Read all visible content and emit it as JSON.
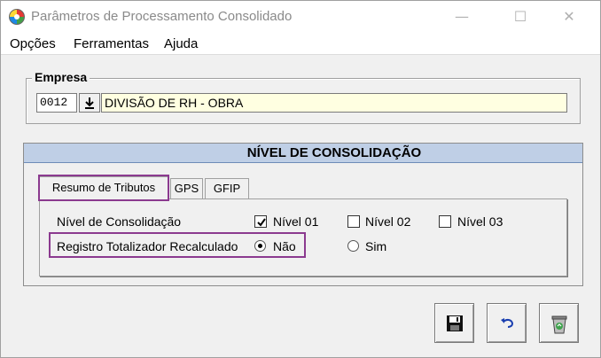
{
  "window": {
    "title": "Parâmetros de Processamento Consolidado",
    "min_symbol": "—",
    "max_symbol": "☐",
    "close_symbol": "✕"
  },
  "menu": {
    "items": [
      "Opções",
      "Ferramentas",
      "Ajuda"
    ]
  },
  "empresa": {
    "legend": "Empresa",
    "code": "0012",
    "name": "DIVISÃO DE RH - OBRA",
    "lookup_icon": "download-arrow-icon",
    "name_field_color": "#ffffe1"
  },
  "consolidacao": {
    "header": "NÍVEL DE CONSOLIDAÇÃO",
    "header_color": "#bfcfe6",
    "tabs": [
      {
        "label": "Resumo de Tributos",
        "active": true
      },
      {
        "label": "GPS",
        "active": false
      },
      {
        "label": "GFIP",
        "active": false
      }
    ],
    "nivel": {
      "label": "Nível de Consolidação",
      "options": [
        {
          "label": "Nível 01",
          "checked": true
        },
        {
          "label": "Nível 02",
          "checked": false
        },
        {
          "label": "Nível 03",
          "checked": false
        }
      ]
    },
    "registro": {
      "label": "Registro Totalizador Recalculado",
      "options": [
        {
          "label": "Não",
          "selected": true
        },
        {
          "label": "Sim",
          "selected": false
        }
      ]
    }
  },
  "toolbar": {
    "buttons": [
      {
        "name": "save",
        "icon": "floppy-disk-icon"
      },
      {
        "name": "undo",
        "icon": "undo-arrow-icon"
      },
      {
        "name": "delete",
        "icon": "recycle-bin-icon"
      }
    ]
  },
  "highlight_color": "#8b3a8f"
}
